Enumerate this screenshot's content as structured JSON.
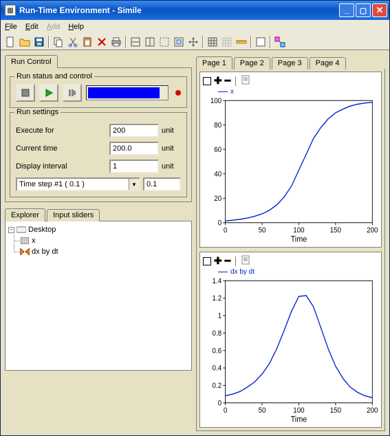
{
  "window": {
    "title": "Run-Time Environment - Simile"
  },
  "menu": {
    "file": "File",
    "edit": "Edit",
    "add": "Add",
    "help": "Help"
  },
  "toolbar_icons": [
    "new-icon",
    "open-icon",
    "save-icon",
    "sep",
    "copy-icon",
    "cut-icon",
    "paste-icon",
    "delete-icon",
    "print-icon",
    "sep",
    "pane-h-icon",
    "pane-v-icon",
    "frame-icon",
    "select-icon",
    "move-icon",
    "sep",
    "grid-icon",
    "grid-off-icon",
    "ruler-icon",
    "sep",
    "blank-icon",
    "sep",
    "link-icon"
  ],
  "left": {
    "run_control_tab": "Run Control",
    "status_group": "Run status and control",
    "progress_pct": 88,
    "settings_group": "Run settings",
    "rows": {
      "execute_for": {
        "label": "Execute for",
        "value": "200",
        "unit": "unit"
      },
      "current_time": {
        "label": "Current time",
        "value": "200.0",
        "unit": "unit"
      },
      "display_interval": {
        "label": "Display interval",
        "value": "1",
        "unit": "unit"
      },
      "timestep_label": "Time step #1 ( 0.1 )",
      "timestep_value": "0.1"
    },
    "explorer_tab": "Explorer",
    "sliders_tab": "Input sliders",
    "tree": {
      "root": "Desktop",
      "children": [
        {
          "label": "x",
          "icon": "box"
        },
        {
          "label": "dx by dt",
          "icon": "valve"
        }
      ]
    }
  },
  "right": {
    "tabs": [
      "Page 1",
      "Page 2",
      "Page 3",
      "Page 4"
    ],
    "charts": [
      {
        "legend": "x",
        "chart_ref": 0
      },
      {
        "legend": "dx by dt",
        "chart_ref": 1
      }
    ]
  },
  "chart_data": [
    {
      "type": "line",
      "title": "",
      "xlabel": "Time",
      "ylabel": "",
      "xlim": [
        0,
        200
      ],
      "ylim": [
        0,
        100
      ],
      "xticks": [
        0,
        50,
        100,
        150,
        200
      ],
      "yticks": [
        0,
        20,
        40,
        60,
        80,
        100
      ],
      "series": [
        {
          "name": "x",
          "color": "#0020cc",
          "x": [
            0,
            10,
            20,
            30,
            40,
            50,
            60,
            70,
            80,
            90,
            100,
            110,
            120,
            130,
            140,
            150,
            160,
            170,
            180,
            190,
            200
          ],
          "y": [
            1.5,
            2,
            2.8,
            3.8,
            5.3,
            7.2,
            10.2,
            14.5,
            21,
            30,
            43,
            56,
            69,
            78,
            85,
            90,
            93,
            95.5,
            97,
            98,
            98.5
          ]
        }
      ]
    },
    {
      "type": "line",
      "title": "",
      "xlabel": "Time",
      "ylabel": "",
      "xlim": [
        0,
        200
      ],
      "ylim": [
        0,
        1.4
      ],
      "xticks": [
        0,
        50,
        100,
        150,
        200
      ],
      "yticks": [
        0,
        0.2,
        0.4,
        0.6,
        0.8,
        1.0,
        1.2,
        1.4
      ],
      "series": [
        {
          "name": "dx by dt",
          "color": "#0020cc",
          "x": [
            0,
            10,
            20,
            30,
            40,
            50,
            60,
            70,
            80,
            90,
            100,
            110,
            120,
            130,
            140,
            150,
            160,
            170,
            180,
            190,
            200
          ],
          "y": [
            0.08,
            0.1,
            0.13,
            0.18,
            0.24,
            0.33,
            0.45,
            0.62,
            0.83,
            1.05,
            1.22,
            1.23,
            1.1,
            0.86,
            0.62,
            0.42,
            0.28,
            0.18,
            0.12,
            0.08,
            0.06
          ]
        }
      ]
    }
  ]
}
